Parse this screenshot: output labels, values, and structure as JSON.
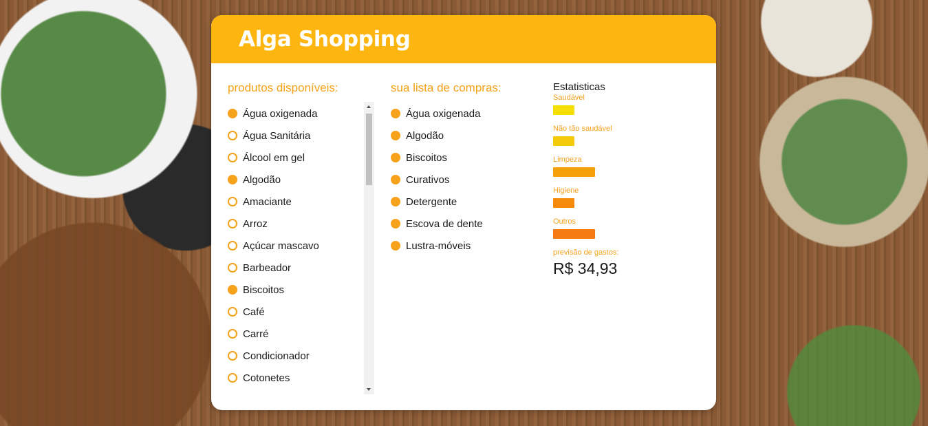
{
  "app": {
    "title": "Alga Shopping"
  },
  "available": {
    "heading": "produtos disponíveis:",
    "items": [
      {
        "label": "Água oxigenada",
        "selected": true
      },
      {
        "label": "Água Sanitária",
        "selected": false
      },
      {
        "label": "Álcool em gel",
        "selected": false
      },
      {
        "label": "Algodão",
        "selected": true
      },
      {
        "label": "Amaciante",
        "selected": false
      },
      {
        "label": "Arroz",
        "selected": false
      },
      {
        "label": "Açúcar mascavo",
        "selected": false
      },
      {
        "label": "Barbeador",
        "selected": false
      },
      {
        "label": "Biscoitos",
        "selected": true
      },
      {
        "label": "Café",
        "selected": false
      },
      {
        "label": "Carré",
        "selected": false
      },
      {
        "label": "Condicionador",
        "selected": false
      },
      {
        "label": "Cotonetes",
        "selected": false
      }
    ]
  },
  "cart": {
    "heading": "sua lista de compras:",
    "items": [
      {
        "label": "Água oxigenada"
      },
      {
        "label": "Algodão"
      },
      {
        "label": "Biscoitos"
      },
      {
        "label": "Curativos"
      },
      {
        "label": "Detergente"
      },
      {
        "label": "Escova de dente"
      },
      {
        "label": "Lustra-móveis"
      }
    ]
  },
  "stats": {
    "title": "Estatisticas",
    "categories": [
      {
        "label": "Saudável",
        "level": 0.5,
        "color": "#F4DF00"
      },
      {
        "label": "Não tão saudável",
        "level": 0.5,
        "color": "#F5CA0B"
      },
      {
        "label": "Limpeza",
        "level": 1.0,
        "color": "#F5A00B"
      },
      {
        "label": "Higiene",
        "level": 0.5,
        "color": "#F58A0B"
      },
      {
        "label": "Outros",
        "level": 1.0,
        "color": "#F57A12"
      }
    ],
    "forecast_label": "previsão de gastos:",
    "forecast_value": "R$ 34,93"
  },
  "colors": {
    "accent": "#FDB50F",
    "heading": "#F4A21C",
    "radio": "#F7A21B"
  }
}
